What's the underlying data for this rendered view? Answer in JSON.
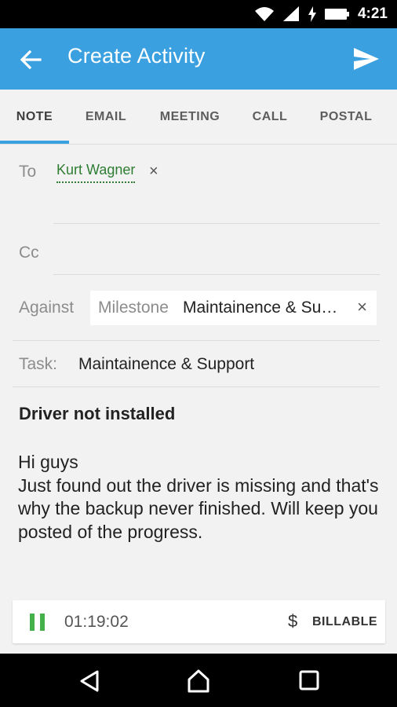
{
  "status_bar": {
    "time": "4:21",
    "icons": [
      "wifi-icon",
      "signal-icon",
      "charging-icon",
      "battery-icon"
    ]
  },
  "app_bar": {
    "title": "Create Activity",
    "back_icon": "arrow-back-icon",
    "send_icon": "send-icon",
    "color": "#3aa0e0"
  },
  "tabs": [
    {
      "label": "NOTE",
      "active": true
    },
    {
      "label": "EMAIL",
      "active": false
    },
    {
      "label": "MEETING",
      "active": false
    },
    {
      "label": "CALL",
      "active": false
    },
    {
      "label": "POSTAL",
      "active": false
    }
  ],
  "form": {
    "to_label": "To",
    "to_recipient": "Kurt Wagner",
    "remove_glyph": "×",
    "cc_label": "Cc",
    "against_label": "Against",
    "against_type": "Milestone",
    "against_value": "Maintainence & Su…",
    "task_label": "Task:",
    "task_value": "Maintainence & Support",
    "subject": "Driver not installed",
    "body": "Hi guys\nJust found out the driver is missing and that's why the backup never finished. Will keep you posted of the progress."
  },
  "timer": {
    "elapsed": "01:19:02",
    "currency_symbol": "$",
    "billable_label": "BILLABLE",
    "accent": "#43b049"
  },
  "nav_bar": {
    "icons": [
      "back-triangle-icon",
      "home-icon",
      "recents-icon"
    ]
  }
}
